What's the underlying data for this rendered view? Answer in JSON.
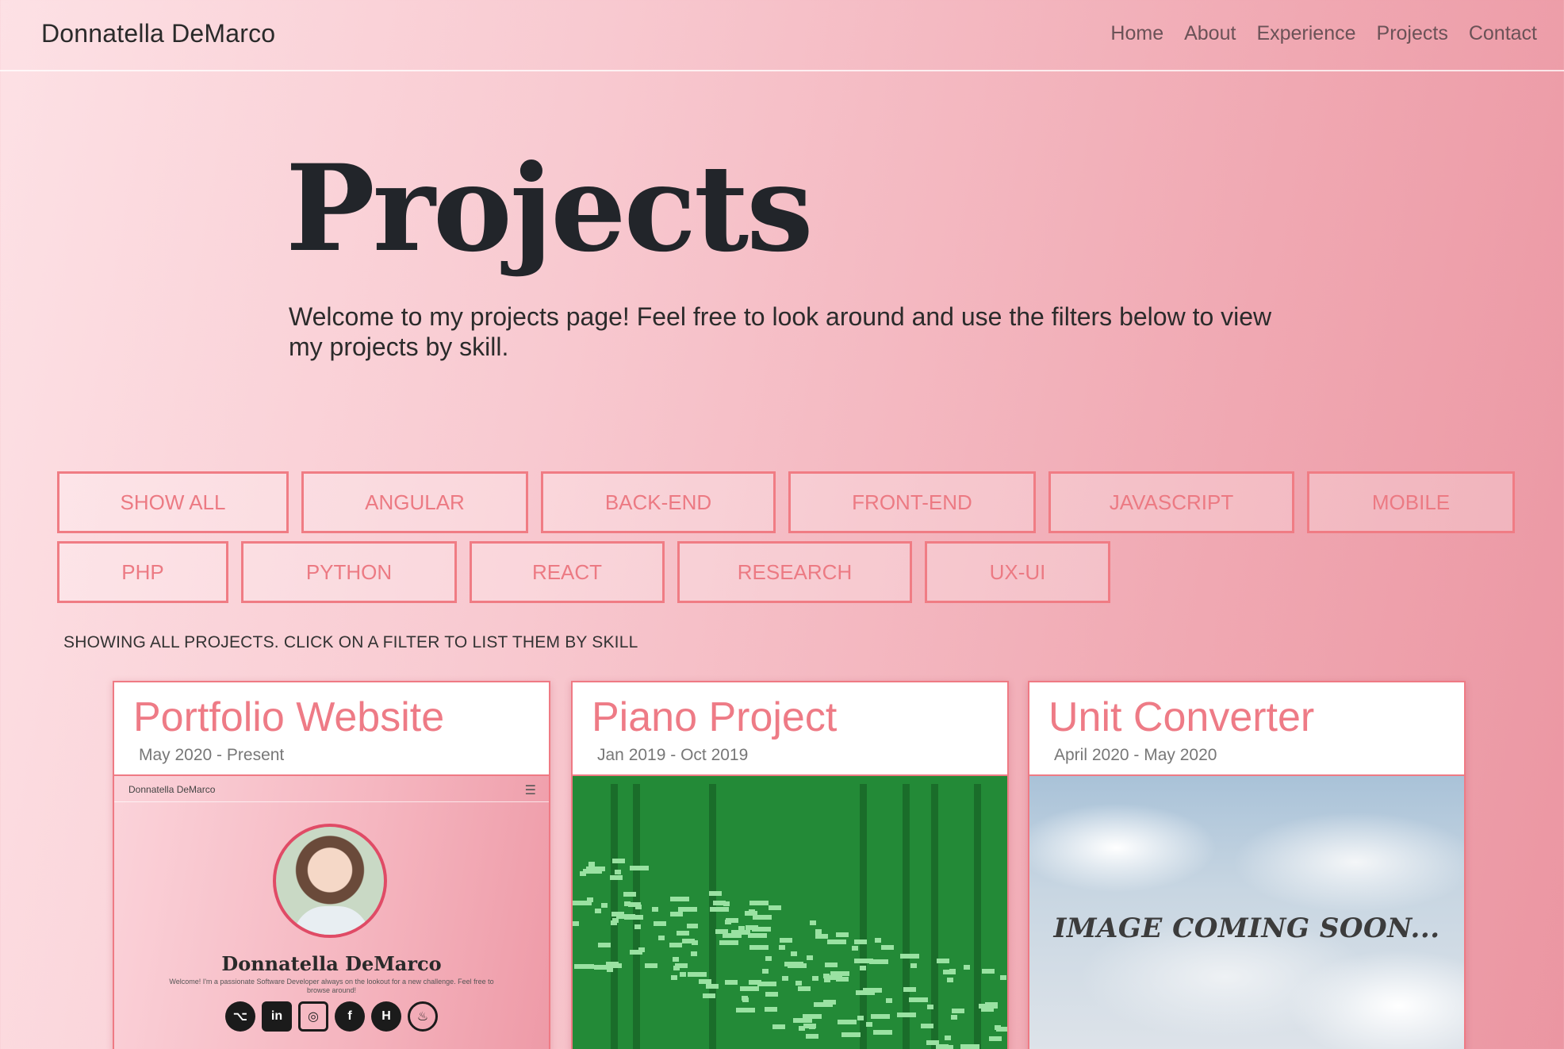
{
  "nav": {
    "brand": "Donnatella DeMarco",
    "links": [
      "Home",
      "About",
      "Experience",
      "Projects",
      "Contact"
    ]
  },
  "hero": {
    "title": "Projects",
    "subtitle": "Welcome to my projects page! Feel free to look around and use the filters below to view my projects by skill."
  },
  "filters": [
    "SHOW ALL",
    "ANGULAR",
    "BACK-END",
    "FRONT-END",
    "JAVASCRIPT",
    "MOBILE",
    "PHP",
    "PYTHON",
    "REACT",
    "RESEARCH",
    "UX-UI"
  ],
  "filter_status": "SHOWING ALL PROJECTS. CLICK ON A FILTER TO LIST THEM BY SKILL",
  "projects": [
    {
      "title": "Portfolio Website",
      "date": "May 2020 - Present",
      "thumb": {
        "brand": "Donnatella DeMarco",
        "name": "Donnatella DeMarco",
        "welcome": "Welcome! I'm a passionate Software Developer always on the lookout for a new challenge. Feel free to browse around!",
        "icons": [
          "github-icon",
          "linkedin-icon",
          "instagram-icon",
          "facebook-icon",
          "hackerrank-icon",
          "freecodecamp-icon"
        ]
      }
    },
    {
      "title": "Piano Project",
      "date": "Jan 2019 - Oct 2019"
    },
    {
      "title": "Unit Converter",
      "date": "April 2020 - May 2020",
      "thumb": {
        "caption": "IMAGE COMING SOON..."
      }
    }
  ],
  "colors": {
    "accent": "#ef7a84",
    "piano_bg": "#238a37",
    "piano_notes": "#9ae2a2"
  }
}
